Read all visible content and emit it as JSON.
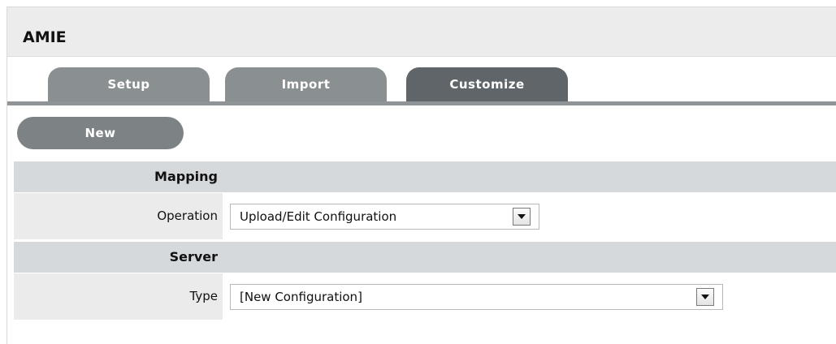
{
  "app": {
    "title": "AMIE"
  },
  "tabs": [
    {
      "label": "Setup",
      "active": false
    },
    {
      "label": "Import",
      "active": false
    },
    {
      "label": "Customize",
      "active": true
    }
  ],
  "actions": {
    "new_label": "New"
  },
  "sections": {
    "mapping": {
      "heading": "Mapping",
      "operation_label": "Operation",
      "operation_value": "Upload/Edit Configuration"
    },
    "server": {
      "heading": "Server",
      "type_label": "Type",
      "type_value": "[New Configuration]"
    }
  },
  "icons": {
    "dropdown": "chevron-down-icon"
  },
  "colors": {
    "tab_inactive": "#8a9091",
    "tab_active": "#5f6568",
    "section_bg": "#d6d9db",
    "label_bg": "#ebebeb"
  }
}
